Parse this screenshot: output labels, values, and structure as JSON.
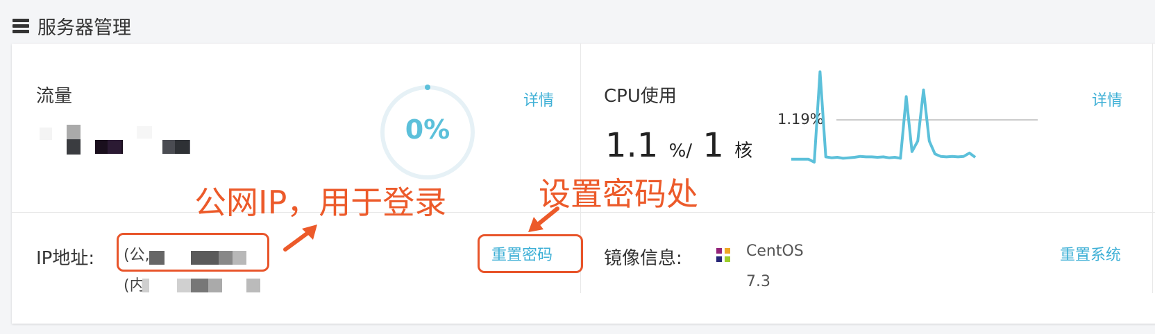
{
  "header": {
    "title": "服务器管理",
    "icon": "server-list-icon"
  },
  "traffic": {
    "title": "流量",
    "detail_link": "详情",
    "gauge_value": "0%",
    "gauge_progress": 0
  },
  "cpu": {
    "title": "CPU使用",
    "detail_link": "详情",
    "usage_value": "1.1",
    "usage_unit": "%",
    "separator": "/",
    "cores_value": "1",
    "cores_unit": "核",
    "reference_label": "1.19%",
    "series": [
      2.2,
      2.2,
      2.2,
      2.2,
      1.6,
      20.5,
      2.7,
      2.5,
      2.6,
      2.4,
      2.5,
      2.6,
      2.8,
      2.7,
      2.7,
      2.6,
      2.7,
      2.5,
      2.6,
      2.4,
      15.3,
      3.8,
      6.0,
      16.7,
      6.0,
      3.3,
      2.8,
      2.7,
      2.8,
      2.7,
      2.8,
      3.5,
      2.6
    ]
  },
  "ip": {
    "label": "IP地址:",
    "public_prefix": "(公,",
    "private_prefix": "(内,",
    "reset_password": "重置密码"
  },
  "image": {
    "label": "镜像信息:",
    "os_name": "CentOS",
    "os_version": "7.3",
    "reset_system": "重置系统",
    "os_icon": "centos-logo-icon"
  },
  "annotations": {
    "public_ip_note": "公网IP，用于登录",
    "reset_password_note": "设置密码处"
  },
  "colors": {
    "accent": "#3fb0d6",
    "annotation": "#ec5a2a",
    "chart_line": "#5cc0da"
  }
}
